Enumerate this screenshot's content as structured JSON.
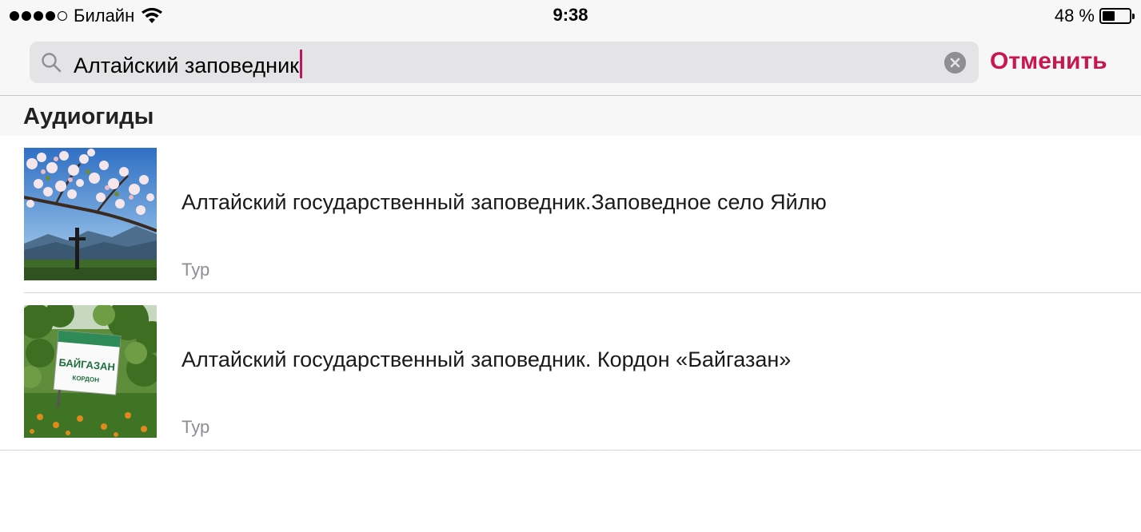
{
  "status_bar": {
    "carrier": "Билайн",
    "time": "9:38",
    "battery_percent": "48 %",
    "battery_level": 0.48,
    "signal_bars": 4
  },
  "search": {
    "query": "Алтайский заповедник",
    "cancel_label": "Отменить",
    "accent_color": "#c8174e"
  },
  "results": {
    "section_title": "Аудиогиды",
    "items": [
      {
        "title": "Алтайский государственный заповедник.Заповедное село Яйлю",
        "subtitle": "Тур",
        "thumbnail": "apple-blossom-cross-photo"
      },
      {
        "title": "Алтайский государственный заповедник. Кордон «Байгазан»",
        "subtitle": "Тур",
        "thumbnail": "baygazan-sign-photo",
        "sign_text": "БАЙГАЗАН",
        "sign_subtext": "КОРДОН"
      }
    ]
  }
}
